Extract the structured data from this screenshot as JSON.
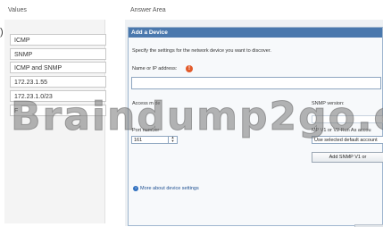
{
  "left_edge_glyph": ")",
  "values_panel": {
    "header": "Values",
    "items": [
      "ICMP",
      "SNMP",
      "ICMP and SNMP",
      "172.23.1.55",
      "172.23.1.0/23",
      "F"
    ]
  },
  "answer_area": {
    "header": "Answer Area"
  },
  "dialog": {
    "title": "Add a Device",
    "instructions": "Specify the settings for the network device you want to discover.",
    "name_label": "Name or IP address:",
    "access_label": "Access m  de",
    "port_label": "Port number",
    "port_value": "161",
    "snmp_version_label": "SNMP version:",
    "snmp_partial": "MP V1 or V2 Run As accou",
    "snmp_account_option": "Use selected default account",
    "add_snmp_button": "Add SNMP V1 or",
    "more_link": "More about device settings"
  },
  "watermark": "Braindump2go.c",
  "colors": {
    "titlebar": "#4a78ad",
    "link": "#1d4f91",
    "warning": "#e25a2a"
  }
}
